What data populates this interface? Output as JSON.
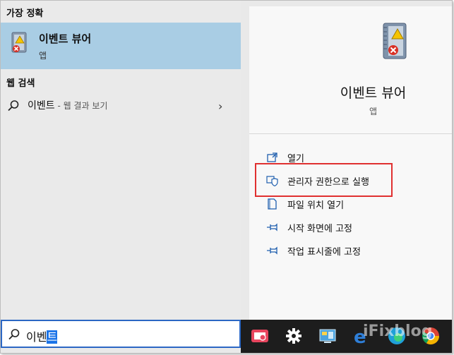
{
  "left": {
    "best_match_header": "가장 정확",
    "best_match": {
      "title": "이벤트 뷰어",
      "subtitle": "앱"
    },
    "web_header": "웹 검색",
    "web_result": {
      "term": "이벤트",
      "suffix": " - 웹 결과 보기"
    }
  },
  "right": {
    "app_title": "이벤트 뷰어",
    "app_subtitle": "앱",
    "actions": [
      {
        "label": "열기",
        "icon": "open-icon"
      },
      {
        "label": "관리자 권한으로 실행",
        "icon": "shield-icon"
      },
      {
        "label": "파일 위치 열기",
        "icon": "file-location-icon"
      },
      {
        "label": "시작 화면에 고정",
        "icon": "pin-icon"
      },
      {
        "label": "작업 표시줄에 고정",
        "icon": "pin-icon"
      }
    ]
  },
  "search": {
    "typed": "이벤",
    "selected": "트"
  },
  "taskbar": {
    "icons": [
      "media-app-icon",
      "settings-gear-icon",
      "control-panel-icon",
      "edge-legacy-icon",
      "edge-icon",
      "chrome-icon"
    ],
    "watermark": "iFixblog"
  },
  "colors": {
    "selection": "#a9cde4",
    "highlight": "#e03030",
    "search_border": "#2b67c4",
    "taskbar": "#1d1d1d"
  }
}
